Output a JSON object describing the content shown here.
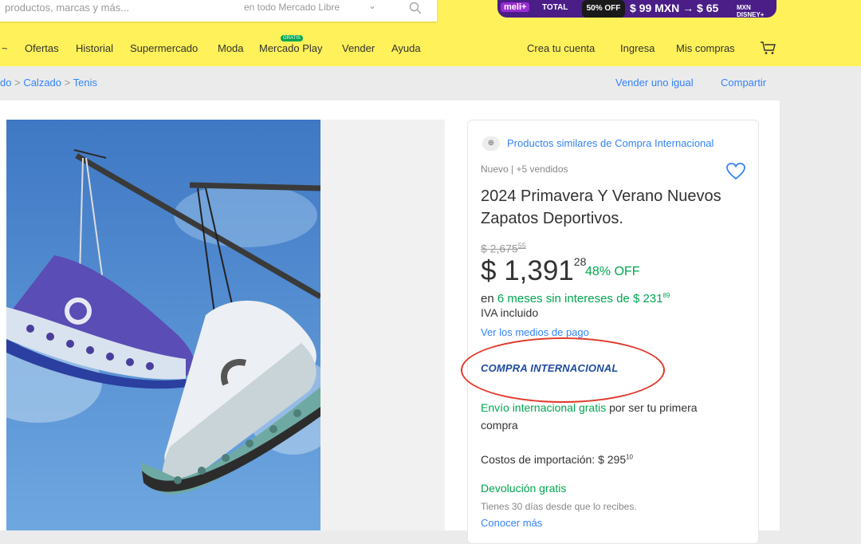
{
  "search": {
    "placeholder": "productos, marcas y más...",
    "scope": "en todo Mercado Libre",
    "chevron": "⌄"
  },
  "promo": {
    "p1": "meli+",
    "p2": "TOTAL",
    "p3": "50% OFF",
    "p4": "$ 99 MXN → $ 65",
    "p5": "MXN DISNEY+"
  },
  "nav": {
    "first": "~",
    "items": [
      "Ofertas",
      "Historial",
      "Supermercado",
      "Moda",
      "Mercado Play",
      "Vender",
      "Ayuda"
    ],
    "badge": "GRATIS",
    "account": [
      "Crea tu cuenta",
      "Ingresa",
      "Mis compras"
    ]
  },
  "breadcrumb": {
    "items": [
      "do",
      "Calzado",
      "Tenis"
    ],
    "separator": ">"
  },
  "page_links": {
    "sell": "Vender uno igual",
    "share": "Compartir"
  },
  "product": {
    "similar_icon": "⊕",
    "similar": "Productos similares de Compra Internacional",
    "meta": "Nuevo  |  +5 vendidos",
    "title": "2024 Primavera Y Verano Nuevos Zapatos Deportivos.",
    "old_price": "$ 2,675",
    "old_cents": "55",
    "price": "$ 1,391",
    "price_cents": "28",
    "discount": "48% OFF",
    "install_prefix": "en ",
    "install_green": "6 meses sin intereses de $ 231",
    "install_cents": "89",
    "iva": "IVA incluido",
    "payment_link": "Ver los medios de pago",
    "international": "COMPRA INTERNACIONAL",
    "ship_green": "Envío internacional gratis",
    "ship_rest": " por ser tu primera compra",
    "import_costs": "Costos de importación: $ 295",
    "import_cents": "10",
    "return_title": "Devolución gratis",
    "return_sub": "Tienes 30 días desde que lo recibes.",
    "more": "Conocer más"
  },
  "colors": {
    "brand_yellow": "#fff159",
    "link_blue": "#3483fa",
    "green": "#00a650",
    "annotation_red": "#e23a2c"
  }
}
